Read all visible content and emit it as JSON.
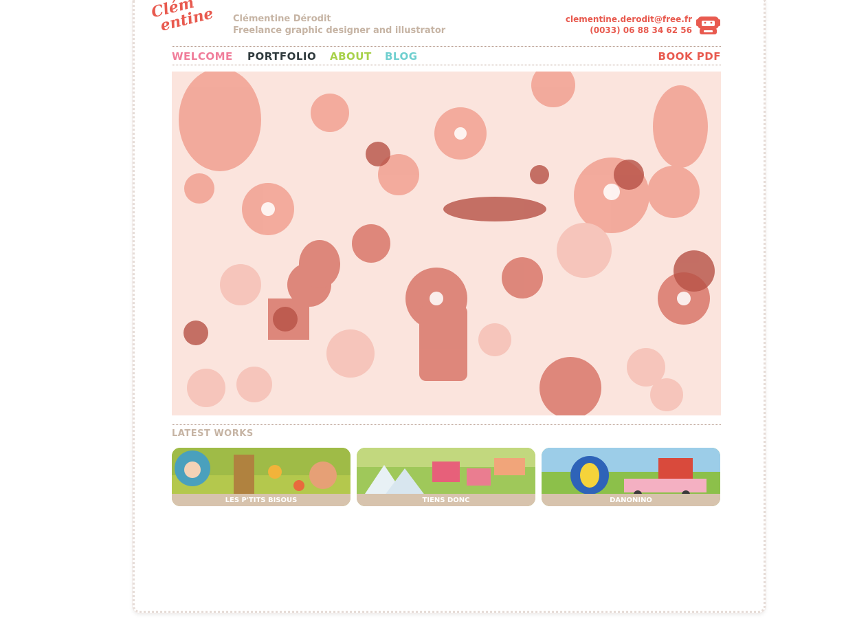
{
  "brand": {
    "logo_line1": "Clém",
    "logo_line2": "entine",
    "name": "Clémentine Dérodit",
    "role": "Freelance graphic designer and illustrator"
  },
  "contact": {
    "email": "clementine.derodit@free.fr",
    "phone": "(0033) 06 88 34 62 56",
    "icon": "phone-character-icon"
  },
  "nav": {
    "items": [
      {
        "label": "WELCOME",
        "color": "#f07d9a"
      },
      {
        "label": "PORTFOLIO",
        "color": "#2f3a3d"
      },
      {
        "label": "ABOUT",
        "color": "#a8d14a"
      },
      {
        "label": "BLOG",
        "color": "#6fcfcf"
      }
    ],
    "book": {
      "label": "BOOK PDF",
      "color": "#e85a4f"
    }
  },
  "latest": {
    "title": "LATEST WORKS",
    "items": [
      {
        "caption": "LES P'TITS BISOUS"
      },
      {
        "caption": "TIENS DONC"
      },
      {
        "caption": "DANONINO"
      }
    ]
  },
  "colors": {
    "accent": "#e85a4f",
    "muted": "#c6b4a4",
    "hero_bg": "#fbe4dd"
  }
}
